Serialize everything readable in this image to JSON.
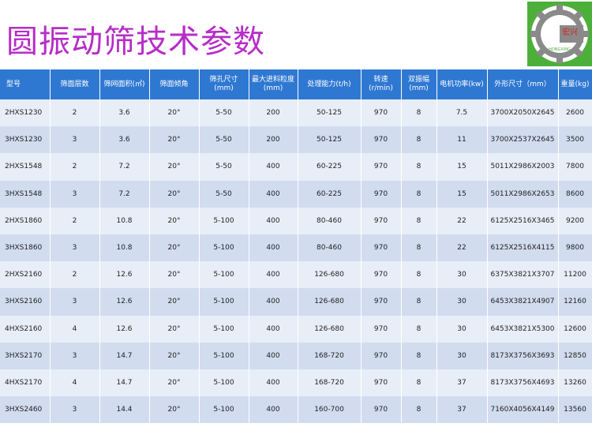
{
  "title": "圆振动筛技术参数",
  "logo": {
    "text": "宏兴",
    "subtext": "HONGXING"
  },
  "colors": {
    "header": "#2f78d2",
    "title": "#b62dc7",
    "row_light": "#e8eef8",
    "row_dark": "#d1dcef"
  },
  "headers": [
    "型号",
    "筛面层数",
    "筛网面积(㎡)",
    "筛面倾角",
    "筛孔尺寸(mm)",
    "最大进料粒度(mm)",
    "处理能力(t/h)",
    "转速(r/min)",
    "双振幅(mm)",
    "电机功率(kw)",
    "外形尺寸（mm）",
    "重量(kg)"
  ],
  "rows": [
    [
      "2HXS1230",
      "2",
      "3.6",
      "20°",
      "5-50",
      "200",
      "50-125",
      "970",
      "8",
      "7.5",
      "3700X2050X2645",
      "2600"
    ],
    [
      "3HXS1230",
      "3",
      "3.6",
      "20°",
      "5-50",
      "200",
      "50-125",
      "970",
      "8",
      "11",
      "3700X2537X2645",
      "3500"
    ],
    [
      "2HXS1548",
      "2",
      "7.2",
      "20°",
      "5-50",
      "400",
      "60-225",
      "970",
      "8",
      "15",
      "5011X2986X2003",
      "7800"
    ],
    [
      "3HXS1548",
      "3",
      "7.2",
      "20°",
      "5-50",
      "400",
      "60-225",
      "970",
      "8",
      "15",
      "5011X2986X2653",
      "8600"
    ],
    [
      "2HXS1860",
      "2",
      "10.8",
      "20°",
      "5-100",
      "400",
      "80-460",
      "970",
      "8",
      "22",
      "6125X2516X3465",
      "9200"
    ],
    [
      "3HXS1860",
      "3",
      "10.8",
      "20°",
      "5-100",
      "400",
      "80-460",
      "970",
      "8",
      "22",
      "6125X2516X4115",
      "9800"
    ],
    [
      "2HXS2160",
      "2",
      "12.6",
      "20°",
      "5-100",
      "400",
      "126-680",
      "970",
      "8",
      "30",
      "6375X3821X3707",
      "11200"
    ],
    [
      "3HXS2160",
      "3",
      "12.6",
      "20°",
      "5-100",
      "400",
      "126-680",
      "970",
      "8",
      "30",
      "6453X3821X4907",
      "12160"
    ],
    [
      "4HXS2160",
      "4",
      "12.6",
      "20°",
      "5-100",
      "400",
      "126-680",
      "970",
      "8",
      "30",
      "6453X3821X5300",
      "12600"
    ],
    [
      "3HXS2170",
      "3",
      "14.7",
      "20°",
      "5-100",
      "400",
      "168-720",
      "970",
      "8",
      "30",
      "8173X3756X3693",
      "12850"
    ],
    [
      "4HXS2170",
      "4",
      "14.7",
      "20°",
      "5-100",
      "400",
      "168-720",
      "970",
      "8",
      "37",
      "8173X3756X4693",
      "13260"
    ],
    [
      "3HXS2460",
      "3",
      "14.4",
      "20°",
      "5-100",
      "400",
      "160-700",
      "970",
      "8",
      "37",
      "7160X4056X4149",
      "13560"
    ]
  ]
}
